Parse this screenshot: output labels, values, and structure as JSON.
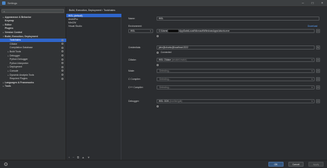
{
  "window": {
    "title": "Settings"
  },
  "sidebar": {
    "items": [
      {
        "label": "Appearance & Behavior",
        "bold": true,
        "arrow": "▸"
      },
      {
        "label": "Keymap",
        "bold": true,
        "arrow": ""
      },
      {
        "label": "Editor",
        "bold": true,
        "arrow": "▸"
      },
      {
        "label": "Plugins",
        "bold": true,
        "arrow": ""
      },
      {
        "label": "Version Control",
        "bold": true,
        "arrow": "▸"
      },
      {
        "label": "Build, Execution, Deployment",
        "bold": true,
        "arrow": "▾"
      },
      {
        "label": "Toolchains",
        "arrow": "",
        "selected": true
      },
      {
        "label": "CMake",
        "arrow": ""
      },
      {
        "label": "Compilation Database",
        "arrow": ""
      },
      {
        "label": "Build Tools",
        "arrow": "▸"
      },
      {
        "label": "Debugger",
        "arrow": "▸"
      },
      {
        "label": "Python Debugger",
        "arrow": ""
      },
      {
        "label": "Python Interpreter",
        "arrow": ""
      },
      {
        "label": "Deployment",
        "arrow": "▸"
      },
      {
        "label": "Console",
        "arrow": "▸"
      },
      {
        "label": "Dynamic Analysis Tools",
        "arrow": "▸"
      },
      {
        "label": "Required Plugins",
        "arrow": ""
      },
      {
        "label": "Languages & Frameworks",
        "bold": true,
        "arrow": "▸"
      },
      {
        "label": "Tools",
        "bold": true,
        "arrow": "▸"
      }
    ]
  },
  "breadcrumb": "Build, Execution, Deployment  ›  Toolchains",
  "toolchains": [
    {
      "label": "WSL (default)",
      "selected": true
    },
    {
      "label": "devkitPro"
    },
    {
      "label": "MinGW"
    },
    {
      "label": "Visual Studio"
    }
  ],
  "form": {
    "name_label": "Name:",
    "name_value": "WSL",
    "environment_label": "Environment:",
    "download_link": "Download",
    "env_type": "WSL",
    "env_path_prefix": "C:\\Users\\",
    "env_path_suffix": "\\AppData\\Local\\Microsoft\\WindowsApps\\ubuntu.exe",
    "credentials_label": "Credentials:",
    "credentials_value": "john@ubuntu@localhost:2222",
    "connected_text": "Connected",
    "cmake_label": "CMake:",
    "cmake_value": "WSL CMake",
    "cmake_version": "(cmake/cmake)",
    "make_label": "Make:",
    "detecting": "Detecting...",
    "c_compiler_label": "C Compiler:",
    "cpp_compiler_label": "C++ Compiler:",
    "debugger_label": "Debugger:",
    "debugger_value": "WSL GDB",
    "debugger_version": "(/usr/bin/gdb)"
  },
  "footer": {
    "ok": "OK",
    "cancel": "Cancel",
    "apply": "Apply"
  }
}
